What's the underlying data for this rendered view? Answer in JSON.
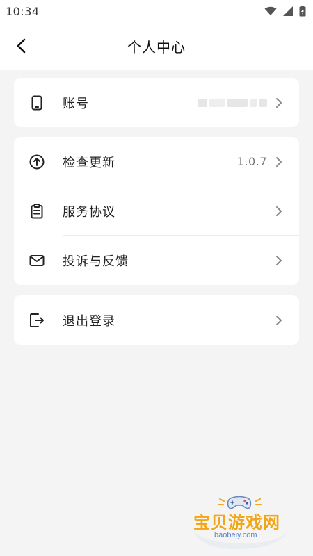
{
  "status_bar": {
    "time": "10:34"
  },
  "header": {
    "title": "个人中心"
  },
  "sections": {
    "account": {
      "label": "账号"
    },
    "update": {
      "label": "检查更新",
      "value": "1.0.7"
    },
    "agreement": {
      "label": "服务协议"
    },
    "feedback": {
      "label": "投诉与反馈"
    },
    "logout": {
      "label": "退出登录"
    }
  },
  "watermark": {
    "title": "宝贝游戏网",
    "domain": "baobeiy.com"
  },
  "colors": {
    "page_background": "#f4f4f4",
    "card_background": "#ffffff",
    "watermark_orange": "#f2a516"
  }
}
